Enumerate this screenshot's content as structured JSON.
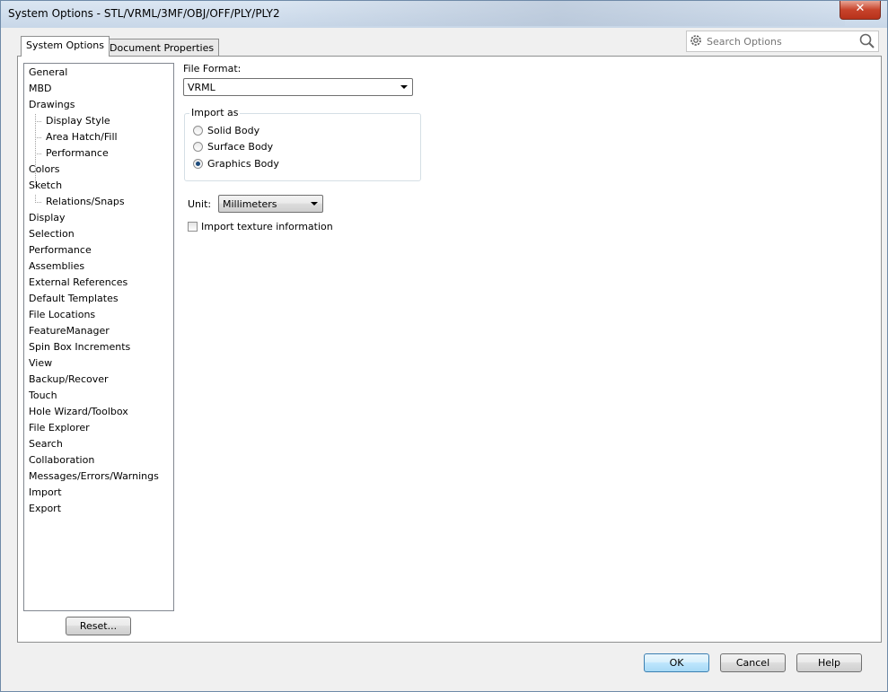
{
  "window": {
    "title": "System Options - STL/VRML/3MF/OBJ/OFF/PLY/PLY2",
    "close_glyph": "✕"
  },
  "tabs": [
    {
      "label": "System Options",
      "active": true
    },
    {
      "label": "Document Properties",
      "active": false
    }
  ],
  "search": {
    "placeholder": "Search Options",
    "icons": [
      "gear-icon",
      "magnifier-icon"
    ]
  },
  "tree": {
    "items": [
      {
        "label": "General",
        "level": 0
      },
      {
        "label": "MBD",
        "level": 0
      },
      {
        "label": "Drawings",
        "level": 0
      },
      {
        "label": "Display Style",
        "level": 1
      },
      {
        "label": "Area Hatch/Fill",
        "level": 1
      },
      {
        "label": "Performance",
        "level": 1
      },
      {
        "label": "Colors",
        "level": 0
      },
      {
        "label": "Sketch",
        "level": 0
      },
      {
        "label": "Relations/Snaps",
        "level": 1
      },
      {
        "label": "Display",
        "level": 0
      },
      {
        "label": "Selection",
        "level": 0
      },
      {
        "label": "Performance",
        "level": 0
      },
      {
        "label": "Assemblies",
        "level": 0
      },
      {
        "label": "External References",
        "level": 0
      },
      {
        "label": "Default Templates",
        "level": 0
      },
      {
        "label": "File Locations",
        "level": 0
      },
      {
        "label": "FeatureManager",
        "level": 0
      },
      {
        "label": "Spin Box Increments",
        "level": 0
      },
      {
        "label": "View",
        "level": 0
      },
      {
        "label": "Backup/Recover",
        "level": 0
      },
      {
        "label": "Touch",
        "level": 0
      },
      {
        "label": "Hole Wizard/Toolbox",
        "level": 0
      },
      {
        "label": "File Explorer",
        "level": 0
      },
      {
        "label": "Search",
        "level": 0
      },
      {
        "label": "Collaboration",
        "level": 0
      },
      {
        "label": "Messages/Errors/Warnings",
        "level": 0
      },
      {
        "label": "Import",
        "level": 0
      },
      {
        "label": "Export",
        "level": 0
      }
    ]
  },
  "reset_button": "Reset...",
  "form": {
    "file_format_label": "File Format:",
    "file_format_value": "VRML",
    "import_as": {
      "title": "Import as",
      "options": [
        {
          "label": "Solid Body",
          "checked": false
        },
        {
          "label": "Surface Body",
          "checked": false
        },
        {
          "label": "Graphics Body",
          "checked": true
        }
      ]
    },
    "unit_label": "Unit:",
    "unit_value": "Millimeters",
    "texture_label": "Import texture information",
    "texture_checked": false
  },
  "footer": {
    "ok": "OK",
    "cancel": "Cancel",
    "help": "Help"
  }
}
